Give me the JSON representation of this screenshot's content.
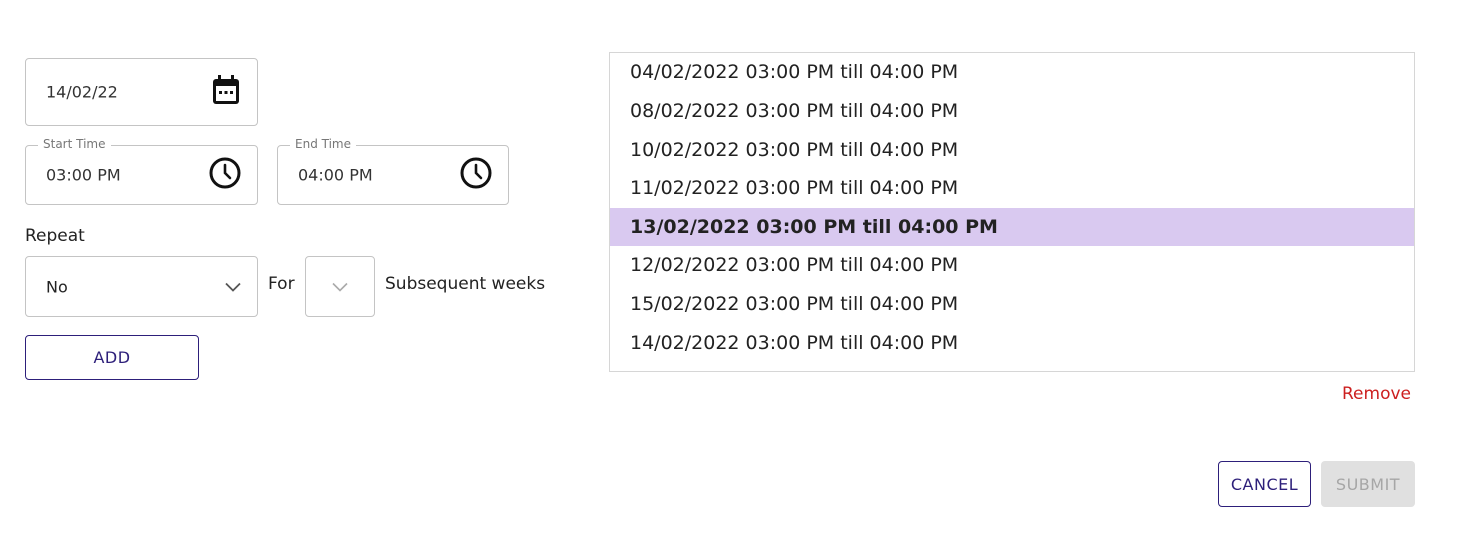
{
  "date": {
    "value": "14/02/22",
    "icon": "calendar-icon"
  },
  "start_time": {
    "legend": "Start Time",
    "value": "03:00 PM",
    "icon": "clock-icon"
  },
  "end_time": {
    "legend": "End Time",
    "value": "04:00 PM",
    "icon": "clock-icon"
  },
  "repeat": {
    "label": "Repeat",
    "selected": "No",
    "for_label": "For",
    "weeks_selected": "",
    "subsequent_label": "Subsequent weeks"
  },
  "add_label": "ADD",
  "slots": [
    {
      "text": "04/02/2022 03:00 PM till 04:00 PM",
      "selected": false
    },
    {
      "text": "08/02/2022 03:00 PM till 04:00 PM",
      "selected": false
    },
    {
      "text": "10/02/2022 03:00 PM till 04:00 PM",
      "selected": false
    },
    {
      "text": "11/02/2022 03:00 PM till 04:00 PM",
      "selected": false
    },
    {
      "text": "13/02/2022 03:00 PM till 04:00 PM",
      "selected": true
    },
    {
      "text": "12/02/2022 03:00 PM till 04:00 PM",
      "selected": false
    },
    {
      "text": "15/02/2022 03:00 PM till 04:00 PM",
      "selected": false
    },
    {
      "text": "14/02/2022 03:00 PM till 04:00 PM",
      "selected": false
    }
  ],
  "remove_label": "Remove",
  "cancel_label": "CANCEL",
  "submit_label": "SUBMIT",
  "colors": {
    "accent": "#2d1f7a",
    "selected_row": "#d9c9f0",
    "danger": "#cc1f1f",
    "disabled_bg": "#e0e0e0",
    "disabled_text": "#a6a6a6"
  }
}
